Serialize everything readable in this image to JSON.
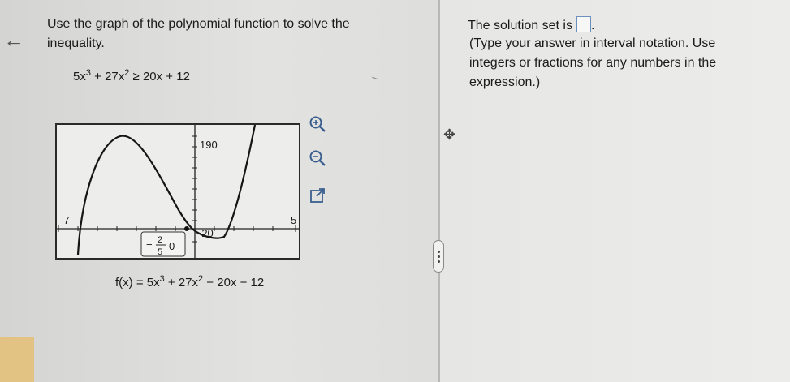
{
  "question": {
    "prompt": "Use the graph of the polynomial function to solve the inequality.",
    "inequality": {
      "lhs_pre": "5x",
      "lhs_exp1": "3",
      "lhs_mid": " + 27x",
      "lhs_exp2": "2",
      "rhs": " ≥ 20x + 12"
    }
  },
  "graph": {
    "y_label": "190",
    "x_min_label": "-7",
    "x_max_label": "5",
    "y_min_label": "-20",
    "point_label_frac_num": "2",
    "point_label_frac_den": "5",
    "point_label_minus": "−",
    "point_label_y": "0"
  },
  "function_label": {
    "pre": "f(x) = 5x",
    "exp1": "3",
    "mid": " + 27x",
    "exp2": "2",
    "post": " − 20x − 12"
  },
  "answer": {
    "prefix": "The solution set is",
    "suffix": ".",
    "instructions": "(Type your answer in interval notation. Use integers or fractions for any numbers in the expression.)"
  },
  "icons": {
    "back": "back-arrow-icon",
    "zoom_in": "zoom-in-icon",
    "zoom_out": "zoom-out-icon",
    "popout": "external-link-icon",
    "move": "move-icon"
  },
  "colors": {
    "accent": "#6b8fbf",
    "corner": "#e3c383"
  }
}
